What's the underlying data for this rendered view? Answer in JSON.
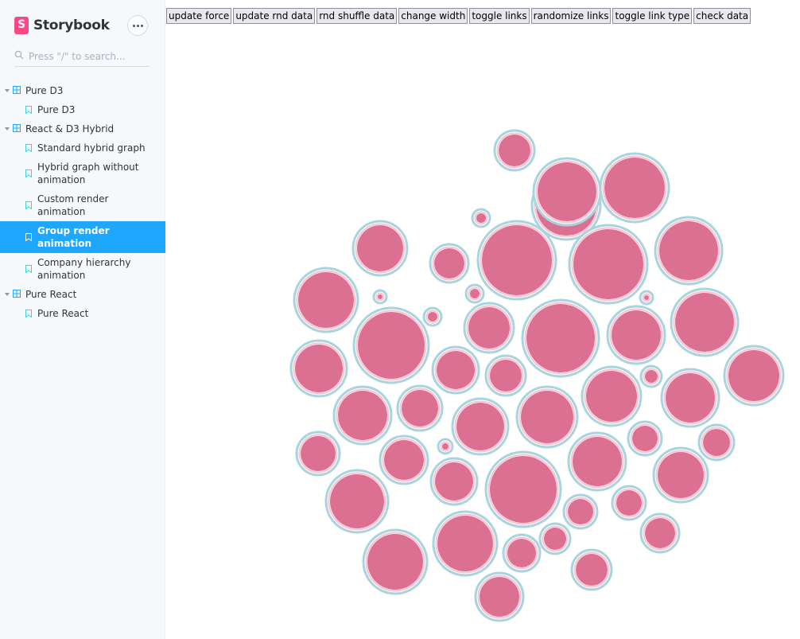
{
  "app": {
    "name": "Storybook"
  },
  "search": {
    "placeholder": "Press \"/\" to search..."
  },
  "sidebar": {
    "groups": [
      {
        "label": "Pure D3",
        "stories": [
          {
            "label": "Pure D3"
          }
        ]
      },
      {
        "label": "React & D3 Hybrid",
        "stories": [
          {
            "label": "Standard hybrid graph"
          },
          {
            "label": "Hybrid graph without animation"
          },
          {
            "label": "Custom render animation"
          },
          {
            "label": "Group render animation",
            "selected": true
          },
          {
            "label": "Company hierarchy animation"
          }
        ]
      },
      {
        "label": "Pure React",
        "stories": [
          {
            "label": "Pure React"
          }
        ]
      }
    ]
  },
  "toolbar": {
    "buttons": [
      "update force",
      "update rnd data",
      "rnd shuffle data",
      "change width",
      "toggle links",
      "randomize links",
      "toggle link type",
      "check data"
    ]
  },
  "colors": {
    "accent": "#1ea7fd",
    "brand": "#ff4785",
    "node_fill": "#dc7092",
    "node_inner_ring": "#f9c3d1",
    "node_outer_ring": "#a8d4e0"
  },
  "icons": {
    "logo": "storybook-logo-icon",
    "menu": "ellipsis-icon",
    "search": "search-icon",
    "group": "component-icon",
    "story": "bookmark-icon",
    "caret": "caret-down-icon"
  }
}
